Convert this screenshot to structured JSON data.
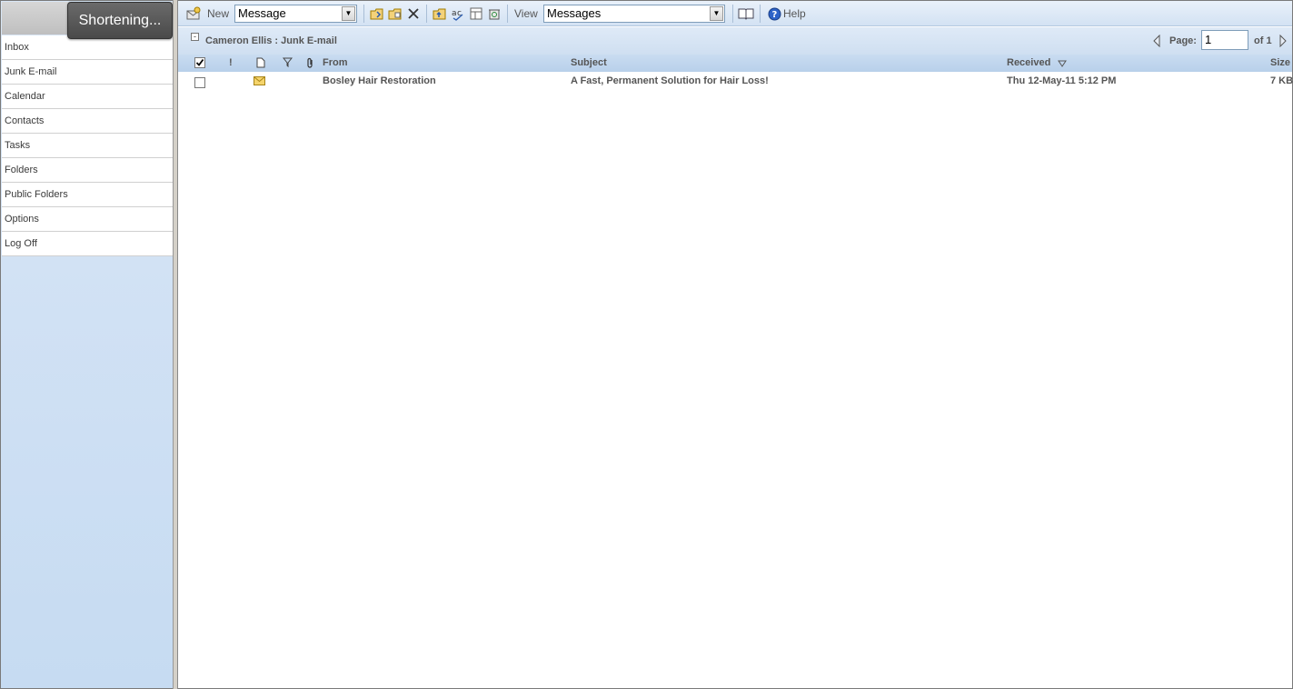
{
  "nav": {
    "status": "Shortening...",
    "items": [
      "Inbox",
      "Junk E-mail",
      "Calendar",
      "Contacts",
      "Tasks",
      "Folders",
      "Public Folders",
      "Options",
      "Log Off"
    ]
  },
  "toolbar": {
    "new_label": "New",
    "new_select": "Message",
    "view_label": "View",
    "view_select": "Messages",
    "help_label": "Help"
  },
  "folder": {
    "title": "Cameron Ellis : Junk E-mail",
    "page_label": "Page:",
    "page_value": "1",
    "page_of": "of 1"
  },
  "columns": {
    "from": "From",
    "subject": "Subject",
    "received": "Received",
    "size": "Size"
  },
  "messages": [
    {
      "from": "Bosley Hair Restoration",
      "subject": "A Fast, Permanent Solution for Hair Loss!",
      "received": "Thu 12-May-11 5:12 PM",
      "size": "7 KB"
    }
  ]
}
